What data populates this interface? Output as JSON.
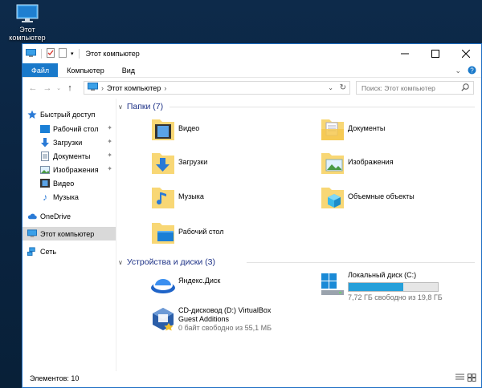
{
  "desktop": {
    "icon_label": "Этот\nкомпьютер"
  },
  "window": {
    "title": "Этот компьютер",
    "controls": [
      "minimize",
      "maximize",
      "close"
    ]
  },
  "ribbon": {
    "tabs": [
      {
        "label": "Файл",
        "active": true
      },
      {
        "label": "Компьютер",
        "active": false
      },
      {
        "label": "Вид",
        "active": false
      }
    ]
  },
  "address": {
    "path": "Этот компьютер",
    "search_placeholder": "Поиск: Этот компьютер"
  },
  "nav": {
    "quick_access": "Быстрый доступ",
    "items": [
      {
        "label": "Рабочий стол",
        "pinned": true
      },
      {
        "label": "Загрузки",
        "pinned": true
      },
      {
        "label": "Документы",
        "pinned": true
      },
      {
        "label": "Изображения",
        "pinned": true
      },
      {
        "label": "Видео",
        "pinned": false
      },
      {
        "label": "Музыка",
        "pinned": false
      }
    ],
    "onedrive": "OneDrive",
    "this_pc": "Этот компьютер",
    "network": "Сеть"
  },
  "folders": {
    "header": "Папки (7)",
    "items": [
      {
        "label": "Видео",
        "icon": "video-folder-icon"
      },
      {
        "label": "Документы",
        "icon": "documents-folder-icon"
      },
      {
        "label": "Загрузки",
        "icon": "downloads-folder-icon"
      },
      {
        "label": "Изображения",
        "icon": "pictures-folder-icon"
      },
      {
        "label": "Музыка",
        "icon": "music-folder-icon"
      },
      {
        "label": "Объемные объекты",
        "icon": "3d-objects-folder-icon"
      },
      {
        "label": "Рабочий стол",
        "icon": "desktop-folder-icon"
      }
    ]
  },
  "devices": {
    "header": "Устройства и диски (3)",
    "yandex": {
      "label": "Яндекс.Диск"
    },
    "local_disk": {
      "label": "Локальный диск (C:)",
      "free_text": "7,72 ГБ свободно из 19,8 ГБ",
      "used_fraction": 0.61
    },
    "cd": {
      "label_line1": "CD-дисковод (D:) VirtualBox",
      "label_line2": "Guest Additions",
      "free_text": "0 байт свободно из 55,1 МБ"
    }
  },
  "status": {
    "items_count": "Элементов: 10"
  },
  "colors": {
    "accent": "#1979ca",
    "folder": "#f8d775",
    "header_text": "#1e3287",
    "bar_fill": "#26a0da"
  }
}
